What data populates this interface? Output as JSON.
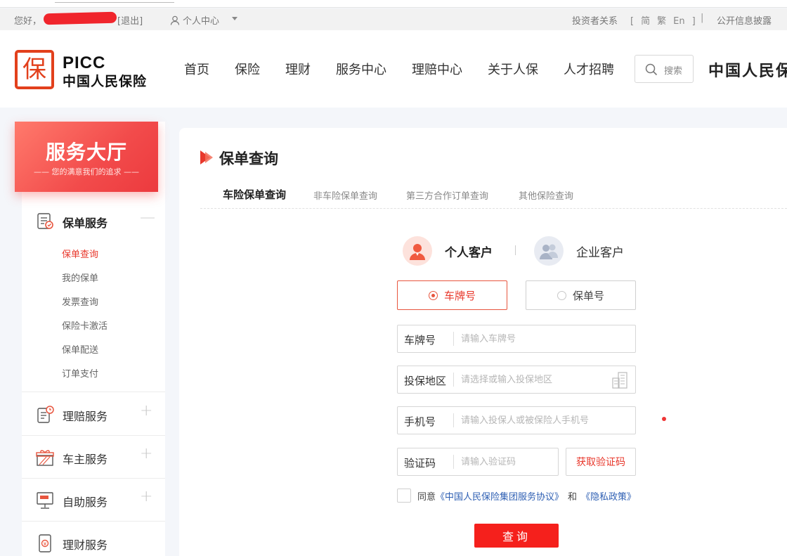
{
  "topbar": {
    "greeting": "您好，",
    "logout": "[退出]",
    "user_center": "个人中心",
    "investor_relations": "投资者关系",
    "lang_open": "[",
    "lang_simplified": "简",
    "lang_traditional": "繁",
    "lang_english": "En",
    "lang_close": "]",
    "separator": "|",
    "disclosure": "公开信息披露"
  },
  "header": {
    "logo_glyph": "保",
    "logo_en": "PICC",
    "logo_cn": "中国人民保险",
    "nav": [
      "首页",
      "保险",
      "理财",
      "服务中心",
      "理赔中心",
      "关于人保",
      "人才招聘"
    ],
    "search_placeholder": "搜索",
    "brand_right": "中国人民保险"
  },
  "sidebar": {
    "hall_title": "服务大厅",
    "hall_subtitle": "—— 您的满意我们的追求 ——",
    "sections": [
      {
        "label": "保单服务",
        "toggle": "—",
        "icon": "policy-document-icon"
      },
      {
        "label": "理赔服务",
        "toggle": "+",
        "icon": "claims-clipboard-icon"
      },
      {
        "label": "车主服务",
        "toggle": "+",
        "icon": "gift-box-icon"
      },
      {
        "label": "自助服务",
        "toggle": "+",
        "icon": "self-service-terminal-icon"
      },
      {
        "label": "理财服务",
        "toggle": "+",
        "icon": "wealth-phone-icon"
      }
    ],
    "policy_items": [
      "保单查询",
      "我的保单",
      "发票查询",
      "保险卡激活",
      "保单配送",
      "订单支付"
    ]
  },
  "main": {
    "title": "保单查询",
    "tabs": [
      "车险保单查询",
      "非车险保单查询",
      "第三方合作订单查询",
      "其他保险查询"
    ],
    "customer_personal": "个人客户",
    "customer_enterprise": "企业客户",
    "option_plate": "车牌号",
    "option_policy": "保单号",
    "fields": {
      "plate_label": "车牌号",
      "plate_placeholder": "请输入车牌号",
      "region_label": "投保地区",
      "region_placeholder": "请选择或输入投保地区",
      "phone_label": "手机号",
      "phone_placeholder": "请输入投保人或被保险人手机号",
      "code_label": "验证码",
      "code_placeholder": "请输入验证码"
    },
    "get_code": "获取验证码",
    "agree_prefix": "同意",
    "agree_link1": "《中国人民保险集团服务协议》",
    "agree_and": "和",
    "agree_link2": "《隐私政策》",
    "query_button": "查询"
  },
  "colors": {
    "brand_red": "#e2401c",
    "accent_red": "#e8382c",
    "button_red": "#f5201c",
    "link_blue": "#2e5fb3"
  }
}
